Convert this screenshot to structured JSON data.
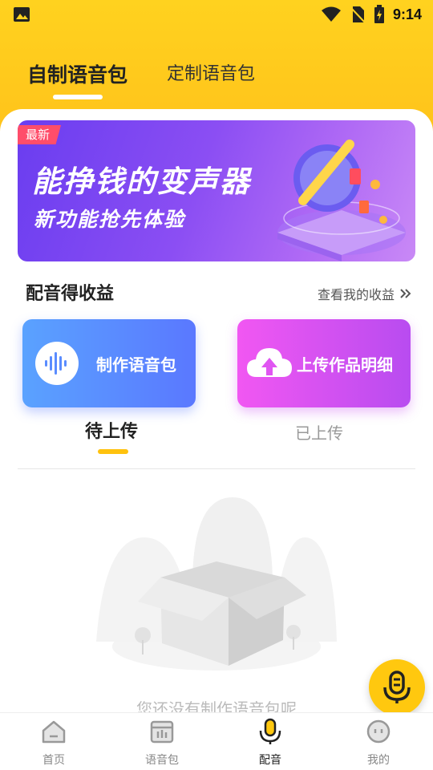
{
  "status_bar": {
    "time": "9:14"
  },
  "header": {
    "tabs": [
      {
        "label": "自制语音包",
        "active": true
      },
      {
        "label": "定制语音包",
        "active": false
      }
    ]
  },
  "banner": {
    "tag": "最新",
    "title": "能挣钱的变声器",
    "subtitle": "新功能抢先体验"
  },
  "earnings": {
    "title": "配音得收益",
    "link": "查看我的收益"
  },
  "cards": {
    "make": {
      "label": "制作语音包"
    },
    "upload": {
      "label": "上传作品明细"
    }
  },
  "subtabs": [
    {
      "label": "待上传",
      "active": true
    },
    {
      "label": "已上传",
      "active": false
    }
  ],
  "empty_state": {
    "text": "您还没有制作语音包呢"
  },
  "bottom_nav": [
    {
      "label": "首页",
      "icon": "home-icon",
      "active": false
    },
    {
      "label": "语音包",
      "icon": "voice-pack-icon",
      "active": false
    },
    {
      "label": "配音",
      "icon": "microphone-icon",
      "active": true
    },
    {
      "label": "我的",
      "icon": "profile-icon",
      "active": false
    }
  ],
  "colors": {
    "brand_yellow": "#ffc80f",
    "banner_purple": "#7a45f2",
    "card_blue": "#5a8cff",
    "card_pink": "#e055f2"
  }
}
